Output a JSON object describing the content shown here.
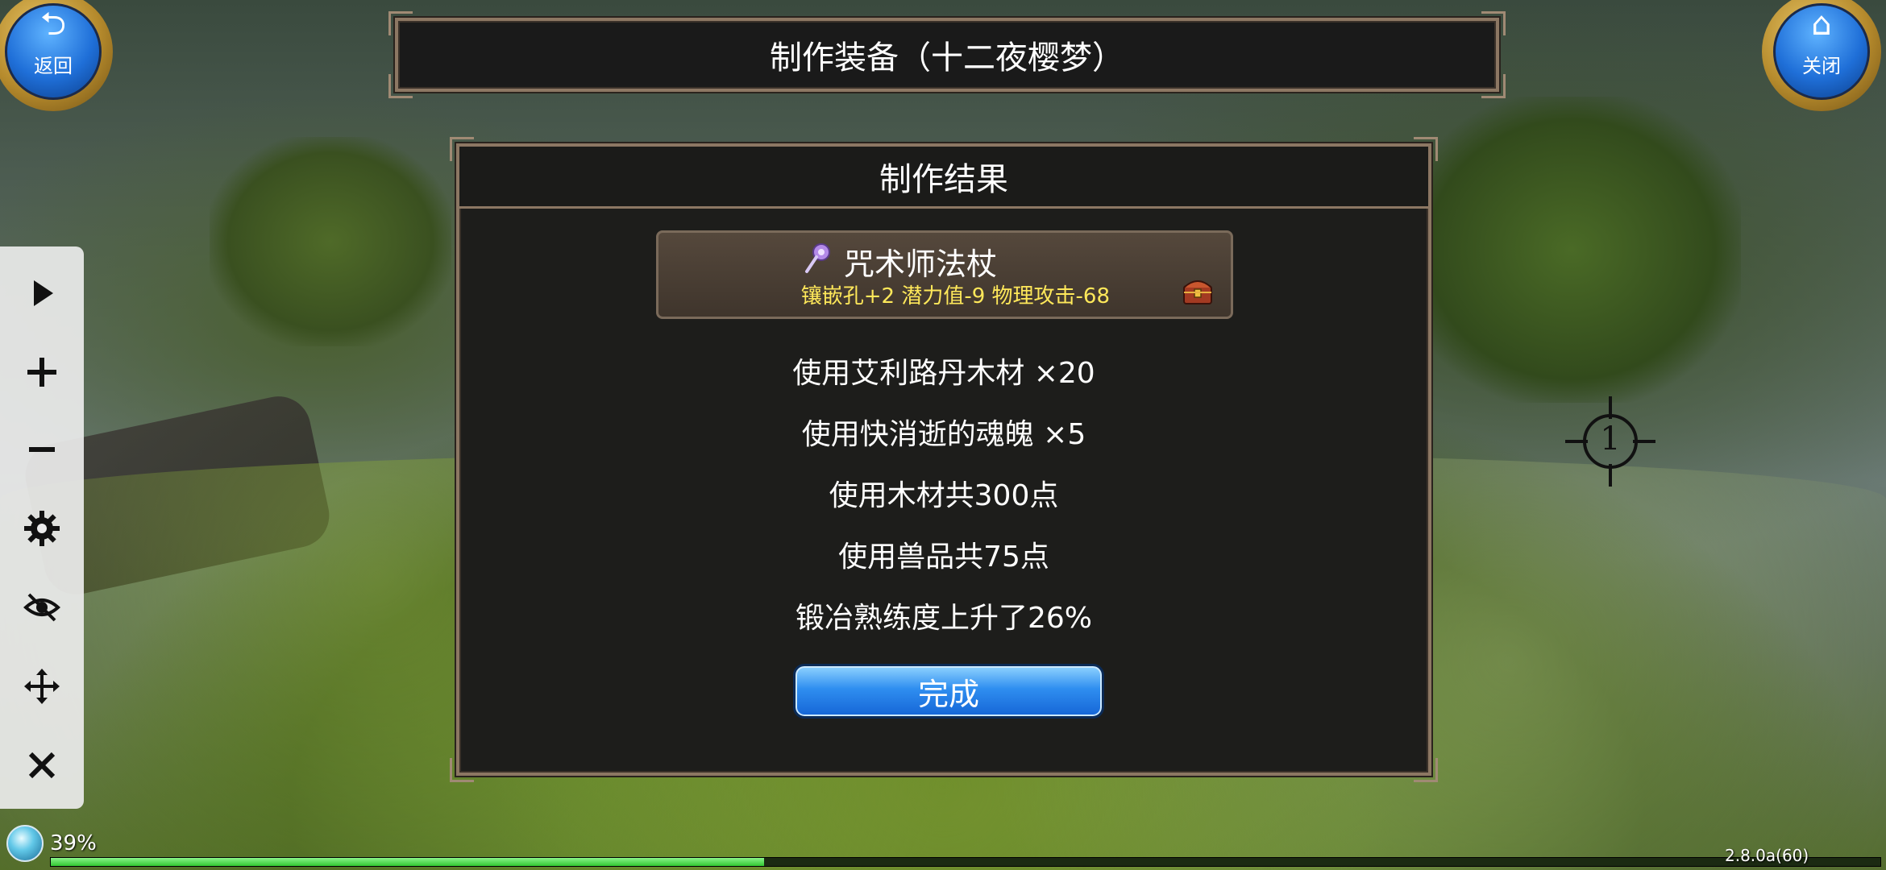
{
  "header": {
    "title": "制作装备（十二夜樱梦）",
    "back_label": "返回",
    "close_label": "关闭"
  },
  "result_panel": {
    "title": "制作结果",
    "item": {
      "name": "咒术师法杖",
      "stats": "镶嵌孔+2 潜力值-9 物理攻击-68",
      "icon": "staff-icon",
      "badge_icon": "treasure-chest-icon"
    },
    "lines": [
      "使用艾利路丹木材 ×20",
      "使用快消逝的魂魄 ×5",
      "使用木材共300点",
      "使用兽品共75点",
      "锻冶熟练度上升了26%"
    ],
    "done_label": "完成"
  },
  "toolbar": {
    "items": [
      "play-icon",
      "plus-icon",
      "minus-icon",
      "gear-icon",
      "eye-off-icon",
      "move-icon",
      "close-icon"
    ]
  },
  "target_marker": {
    "number": "1"
  },
  "status": {
    "percent": "39%",
    "progress": 0.39,
    "version": "2.8.0a(60)"
  },
  "colors": {
    "panel_border": "#8c7763",
    "item_stats": "#ffe85a",
    "button_blue": "#2f8ef0",
    "progress_green": "#32c832"
  }
}
